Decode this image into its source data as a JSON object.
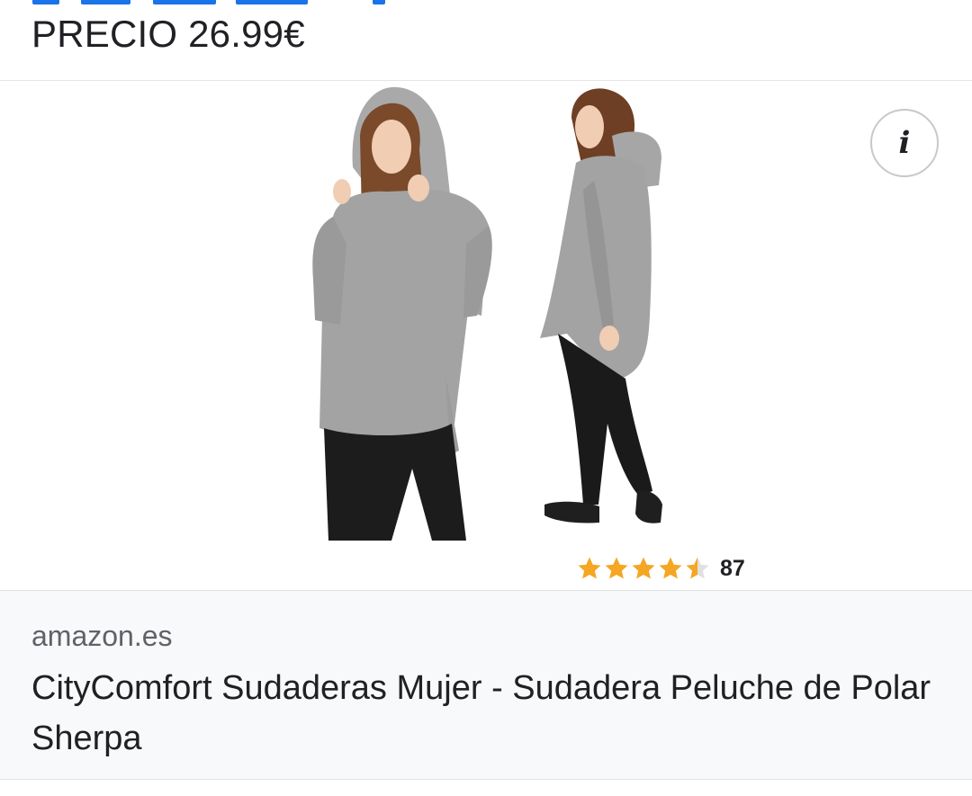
{
  "header": {
    "price_label": "PRECIO 26.99€"
  },
  "image": {
    "alt": "CityComfort Sudaderas Mujer - Sudadera Peluche de Polar Sherpa",
    "info_icon": "info-icon"
  },
  "rating": {
    "stars": 4.5,
    "max_stars": 5,
    "count": "87",
    "star_color": "#f5a623"
  },
  "footer": {
    "domain": "amazon.es",
    "title": "CityComfort Sudaderas Mujer - Sudadera Peluche de Polar Sherpa"
  },
  "colors": {
    "link_blue": "#1a73e8",
    "text": "#202124",
    "muted": "#5f6368",
    "footer_bg": "#f8f9fa"
  }
}
